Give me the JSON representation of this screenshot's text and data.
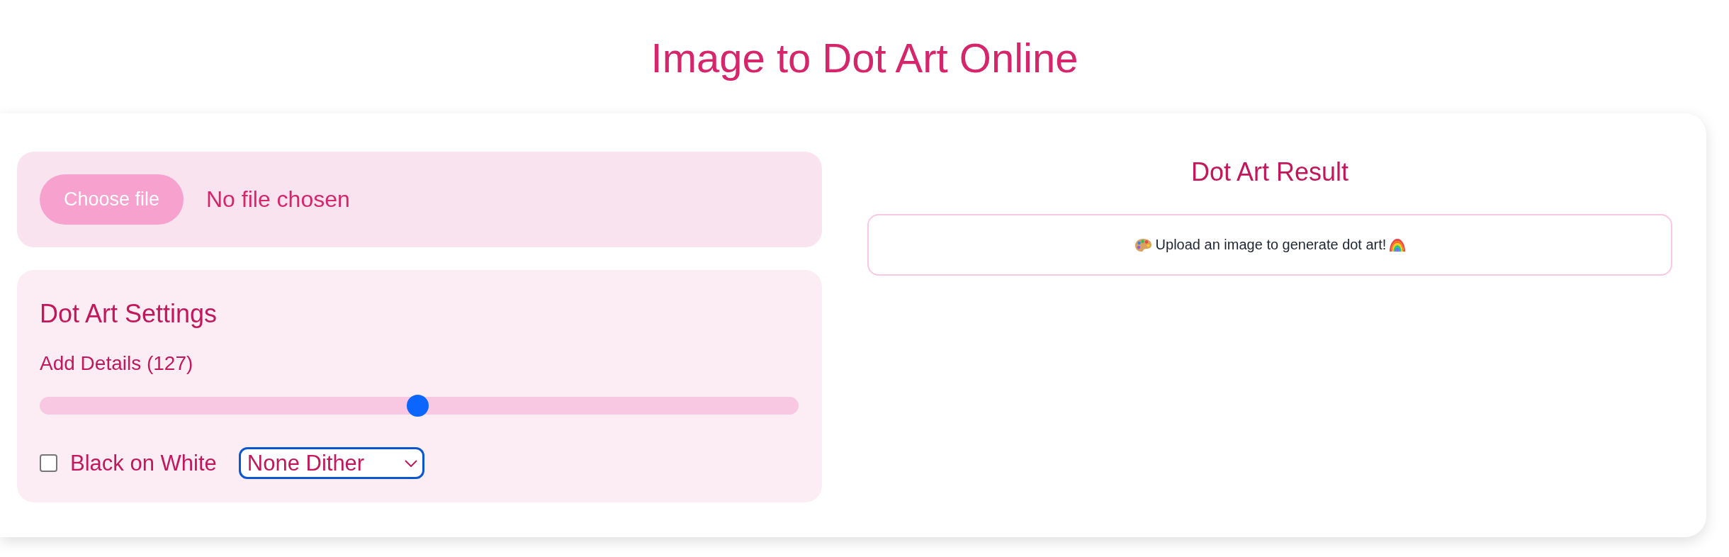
{
  "title": "Image to Dot Art Online",
  "upload": {
    "button": "Choose file",
    "status": "No file chosen"
  },
  "settings": {
    "heading": "Dot Art Settings",
    "detail_label": "Add Details (127)",
    "detail_slider": {
      "level": 0.498
    },
    "black_on_white": {
      "label": "Black on White",
      "checked": false
    },
    "dither_select": {
      "value": "None Dither",
      "focused": true
    }
  },
  "result": {
    "heading": "Dot Art Result",
    "message": "Upload an image to generate dot art!"
  }
}
